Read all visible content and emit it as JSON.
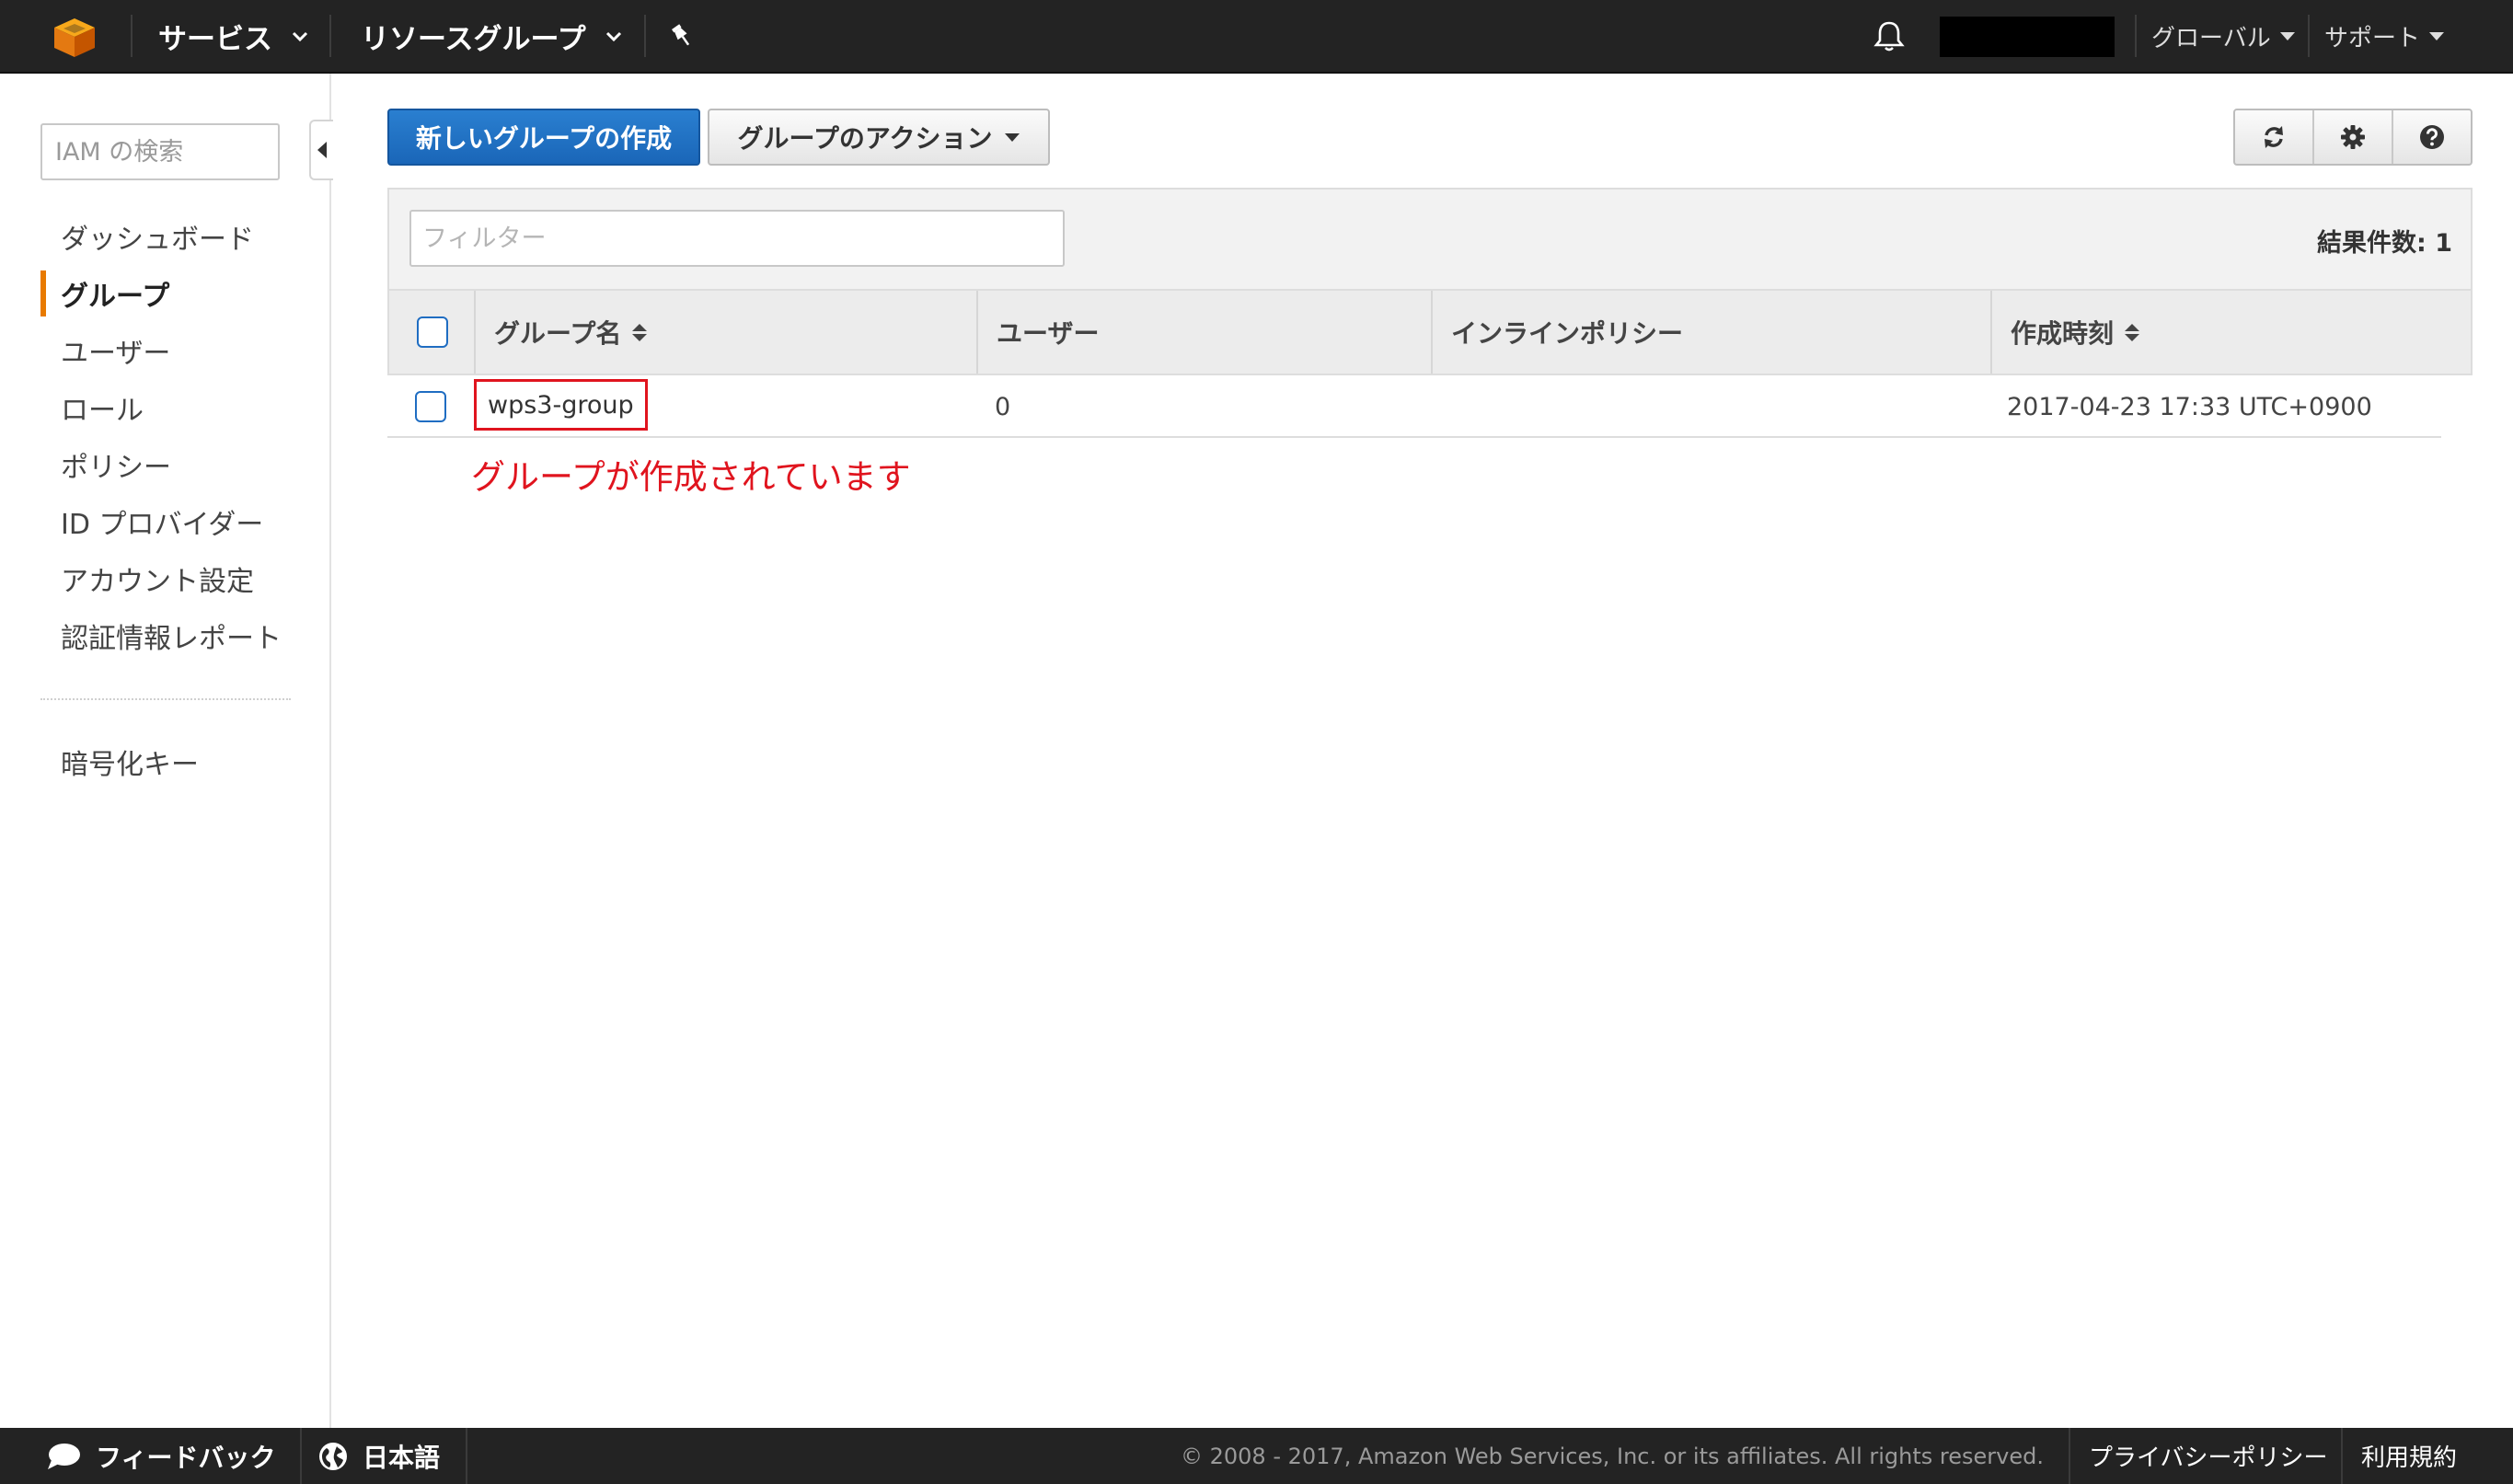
{
  "topbar": {
    "services_label": "サービス",
    "resource_groups_label": "リソースグループ",
    "region_label": "グローバル",
    "support_label": "サポート"
  },
  "sidebar": {
    "search_placeholder": "IAM の検索",
    "items": [
      {
        "label": "ダッシュボード",
        "active": false
      },
      {
        "label": "グループ",
        "active": true
      },
      {
        "label": "ユーザー",
        "active": false
      },
      {
        "label": "ロール",
        "active": false
      },
      {
        "label": "ポリシー",
        "active": false
      },
      {
        "label": "ID プロバイダー",
        "active": false
      },
      {
        "label": "アカウント設定",
        "active": false
      },
      {
        "label": "認証情報レポート",
        "active": false
      }
    ],
    "encryption_keys_label": "暗号化キー"
  },
  "toolbar": {
    "create_group_label": "新しいグループの作成",
    "group_actions_label": "グループのアクション"
  },
  "filter": {
    "placeholder": "フィルター",
    "result_count": "結果件数: 1"
  },
  "table": {
    "columns": [
      "グループ名",
      "ユーザー",
      "インラインポリシー",
      "作成時刻"
    ],
    "rows": [
      {
        "group_name": "wps3-group",
        "users": "0",
        "inline_policy": "",
        "created": "2017-04-23 17:33 UTC+0900"
      }
    ]
  },
  "annotation": "グループが作成されています",
  "footer": {
    "feedback_label": "フィードバック",
    "language_label": "日本語",
    "copyright": "© 2008 - 2017, Amazon Web Services, Inc. or its affiliates. All rights reserved.",
    "privacy_label": "プライバシーポリシー",
    "terms_label": "利用規約"
  },
  "colors": {
    "topbar_bg": "#232323",
    "primary_button": "#1a66b8",
    "active_accent": "#e87a00",
    "annotation_red": "#e0141e"
  }
}
